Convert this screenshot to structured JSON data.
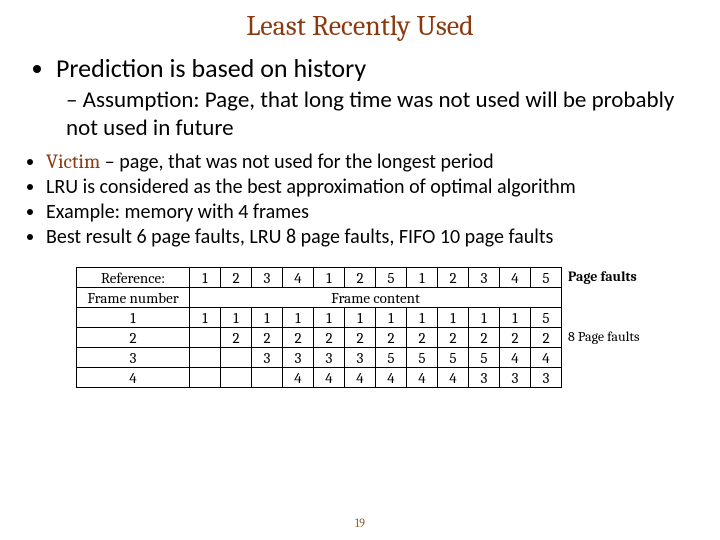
{
  "title": "Least Recently Used",
  "bullets": {
    "main1": "Prediction is based on history",
    "sub1": "Assumption: Page, that long time was not used will be probably not used in future",
    "b1_prefix": "Victim",
    "b1_rest": " – page, that was not used for the longest period",
    "b2": "LRU is considered as the best approximation of optimal algorithm",
    "b3": "Example: memory with 4 frames",
    "b4": "Best result 6 page faults, LRU 8 page faults, FIFO 10 page faults"
  },
  "table": {
    "labels": {
      "ref": "Reference:",
      "frame_num": "Frame number",
      "f1": "1",
      "f2": "2",
      "f3": "3",
      "f4": "4",
      "content": "Frame content"
    },
    "refs": [
      "1",
      "2",
      "3",
      "4",
      "1",
      "2",
      "5",
      "1",
      "2",
      "3",
      "4",
      "5"
    ],
    "rows": {
      "r1": [
        {
          "v": "1",
          "b": true
        },
        {
          "v": "1"
        },
        {
          "v": "1"
        },
        {
          "v": "1"
        },
        {
          "v": "1"
        },
        {
          "v": "1"
        },
        {
          "v": "1"
        },
        {
          "v": "1"
        },
        {
          "v": "1"
        },
        {
          "v": "1"
        },
        {
          "v": "1"
        },
        {
          "v": "5",
          "b": true
        }
      ],
      "r2": [
        {
          "v": ""
        },
        {
          "v": "2",
          "b": true
        },
        {
          "v": "2"
        },
        {
          "v": "2"
        },
        {
          "v": "2"
        },
        {
          "v": "2"
        },
        {
          "v": "2"
        },
        {
          "v": "2"
        },
        {
          "v": "2"
        },
        {
          "v": "2"
        },
        {
          "v": "2"
        },
        {
          "v": "2"
        }
      ],
      "r3": [
        {
          "v": ""
        },
        {
          "v": ""
        },
        {
          "v": "3",
          "b": true
        },
        {
          "v": "3"
        },
        {
          "v": "3"
        },
        {
          "v": "3"
        },
        {
          "v": "5",
          "b": true
        },
        {
          "v": "5"
        },
        {
          "v": "5"
        },
        {
          "v": "5"
        },
        {
          "v": "4",
          "b": true
        },
        {
          "v": "4"
        }
      ],
      "r4": [
        {
          "v": ""
        },
        {
          "v": ""
        },
        {
          "v": ""
        },
        {
          "v": "4",
          "b": true
        },
        {
          "v": "4"
        },
        {
          "v": "4"
        },
        {
          "v": "4"
        },
        {
          "v": "4"
        },
        {
          "v": "4"
        },
        {
          "v": "3",
          "b": true
        },
        {
          "v": "3"
        },
        {
          "v": "3"
        }
      ]
    }
  },
  "aside": {
    "pf": "Page faults",
    "count": "8 Page faults"
  },
  "pagenum": "19"
}
